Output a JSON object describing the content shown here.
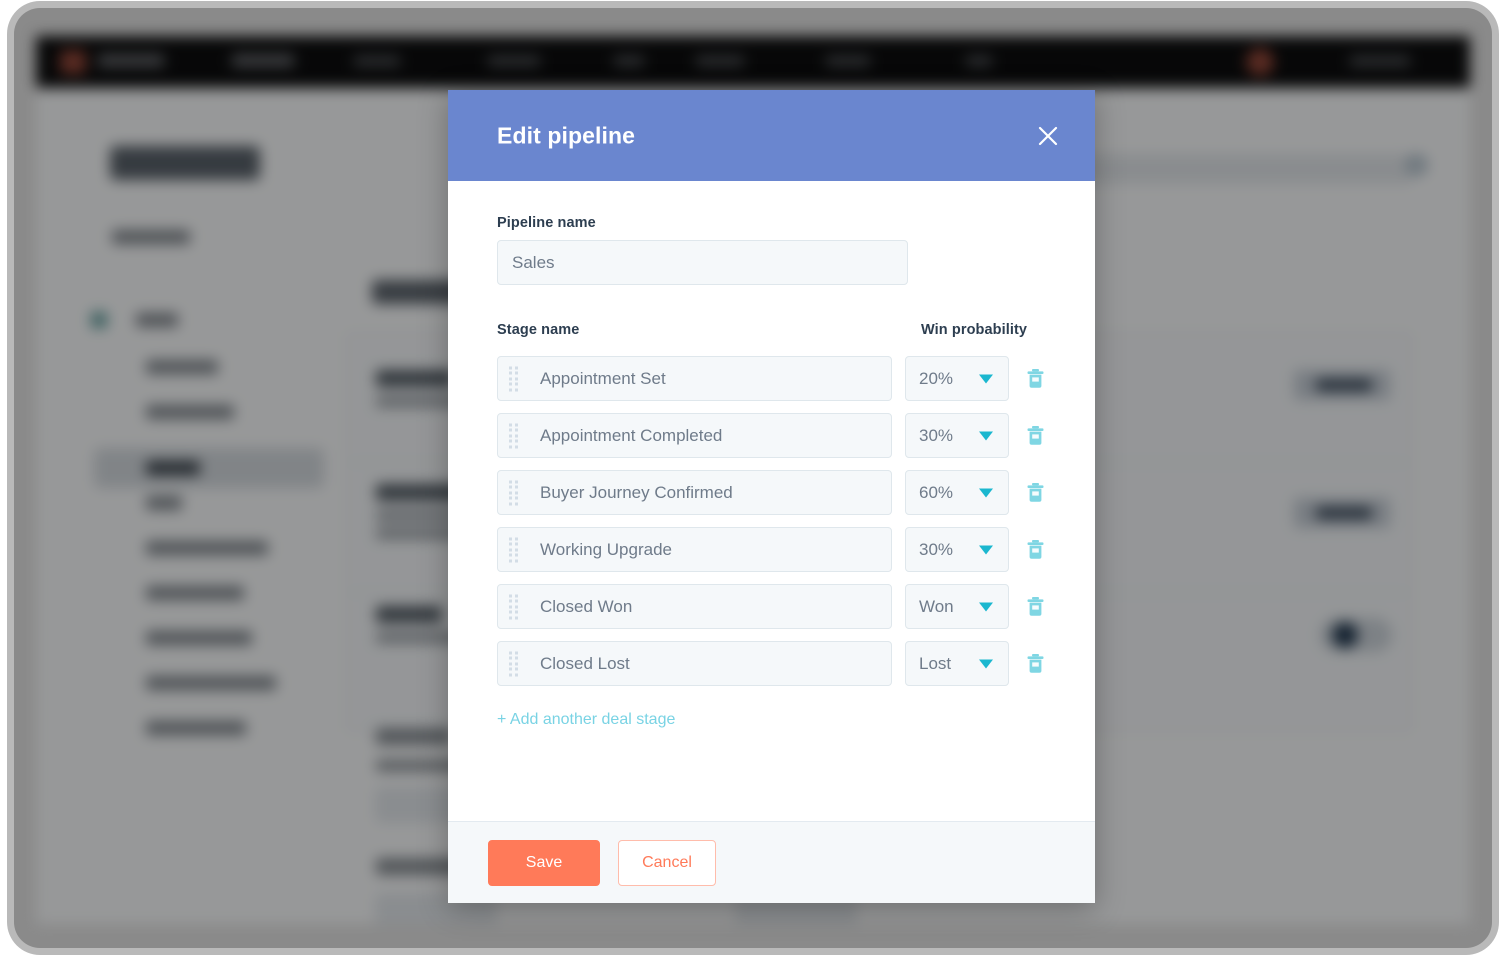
{
  "modal": {
    "title": "Edit pipeline",
    "close_icon": "close-icon",
    "pipeline_name_label": "Pipeline name",
    "pipeline_name_value": "Sales",
    "pipeline_name_placeholder": "Pipeline name",
    "stage_name_header": "Stage name",
    "win_probability_header": "Win probability",
    "stages": [
      {
        "name": "Appointment Set",
        "probability": "20%",
        "drag_icon": "drag-handle-icon",
        "caret_icon": "chevron-down-icon",
        "delete_icon": "trash-icon"
      },
      {
        "name": "Appointment Completed",
        "probability": "30%",
        "drag_icon": "drag-handle-icon",
        "caret_icon": "chevron-down-icon",
        "delete_icon": "trash-icon"
      },
      {
        "name": "Buyer Journey Confirmed",
        "probability": "60%",
        "drag_icon": "drag-handle-icon",
        "caret_icon": "chevron-down-icon",
        "delete_icon": "trash-icon"
      },
      {
        "name": "Working Upgrade",
        "probability": "30%",
        "drag_icon": "drag-handle-icon",
        "caret_icon": "chevron-down-icon",
        "delete_icon": "trash-icon"
      },
      {
        "name": "Closed Won",
        "probability": "Won",
        "drag_icon": "drag-handle-icon",
        "caret_icon": "chevron-down-icon",
        "delete_icon": "trash-icon"
      },
      {
        "name": "Closed Lost",
        "probability": "Lost",
        "drag_icon": "drag-handle-icon",
        "caret_icon": "chevron-down-icon",
        "delete_icon": "trash-icon"
      }
    ],
    "add_stage_label": "+ Add another deal stage",
    "save_label": "Save",
    "cancel_label": "Cancel"
  },
  "colors": {
    "header_blue": "#6a86cf",
    "accent_orange": "#ff7a59",
    "link_cyan": "#79d3e4",
    "caret_teal": "#1bb7cf",
    "trash_teal": "#7fd6e3",
    "label_navy": "#2d3e50",
    "input_fill": "#f5f8fa",
    "input_border": "#dfe7ec",
    "footer_fill": "#f5f8fa"
  }
}
